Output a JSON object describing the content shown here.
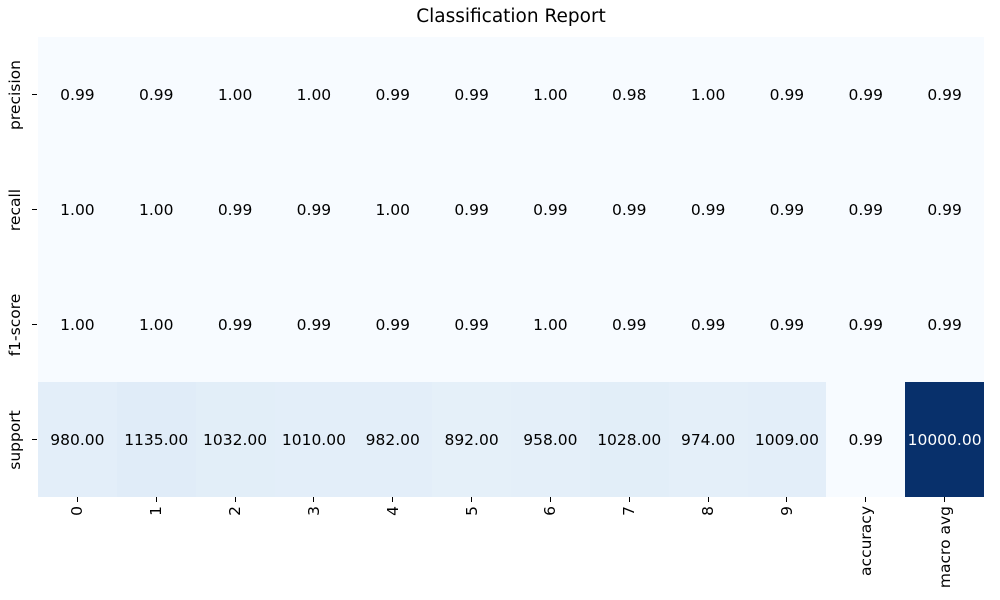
{
  "chart_data": {
    "type": "heatmap",
    "title": "Classification Report",
    "x_tick_labels": [
      "0",
      "1",
      "2",
      "3",
      "4",
      "5",
      "6",
      "7",
      "8",
      "9",
      "accuracy",
      "macro avg"
    ],
    "y_tick_labels": [
      "precision",
      "recall",
      "f1-score",
      "support"
    ],
    "values": [
      [
        0.99,
        0.99,
        1.0,
        1.0,
        0.99,
        0.99,
        1.0,
        0.98,
        1.0,
        0.99,
        0.99,
        0.99
      ],
      [
        1.0,
        1.0,
        0.99,
        0.99,
        1.0,
        0.99,
        0.99,
        0.99,
        0.99,
        0.99,
        0.99,
        0.99
      ],
      [
        1.0,
        1.0,
        0.99,
        0.99,
        0.99,
        0.99,
        1.0,
        0.99,
        0.99,
        0.99,
        0.99,
        0.99
      ],
      [
        980,
        1135,
        1032,
        1010,
        982,
        892,
        958,
        1028,
        974,
        1009,
        0.99,
        10000
      ]
    ],
    "cell_labels": [
      [
        "0.99",
        "0.99",
        "1.00",
        "1.00",
        "0.99",
        "0.99",
        "1.00",
        "0.98",
        "1.00",
        "0.99",
        "0.99",
        "0.99"
      ],
      [
        "1.00",
        "1.00",
        "0.99",
        "0.99",
        "1.00",
        "0.99",
        "0.99",
        "0.99",
        "0.99",
        "0.99",
        "0.99",
        "0.99"
      ],
      [
        "1.00",
        "1.00",
        "0.99",
        "0.99",
        "0.99",
        "0.99",
        "1.00",
        "0.99",
        "0.99",
        "0.99",
        "0.99",
        "0.99"
      ],
      [
        "980.00",
        "1135.00",
        "1032.00",
        "1010.00",
        "982.00",
        "892.00",
        "958.00",
        "1028.00",
        "974.00",
        "1009.00",
        "0.99",
        "10000.00"
      ]
    ],
    "vmin": 0.98,
    "vmax": 10000,
    "colormap": "Blues",
    "colormap_stops": [
      "#f7fbff",
      "#deebf7",
      "#c6dbef",
      "#9ecae1",
      "#6baed6",
      "#4292c6",
      "#2171b5",
      "#08519c",
      "#08306b"
    ],
    "colorbar": false,
    "grid": false,
    "legend_position": "none",
    "annotation_color_on_light": "#000000",
    "annotation_color_on_dark": "#ffffff",
    "background_color": "#ffffff",
    "tick_color": "#000000"
  }
}
